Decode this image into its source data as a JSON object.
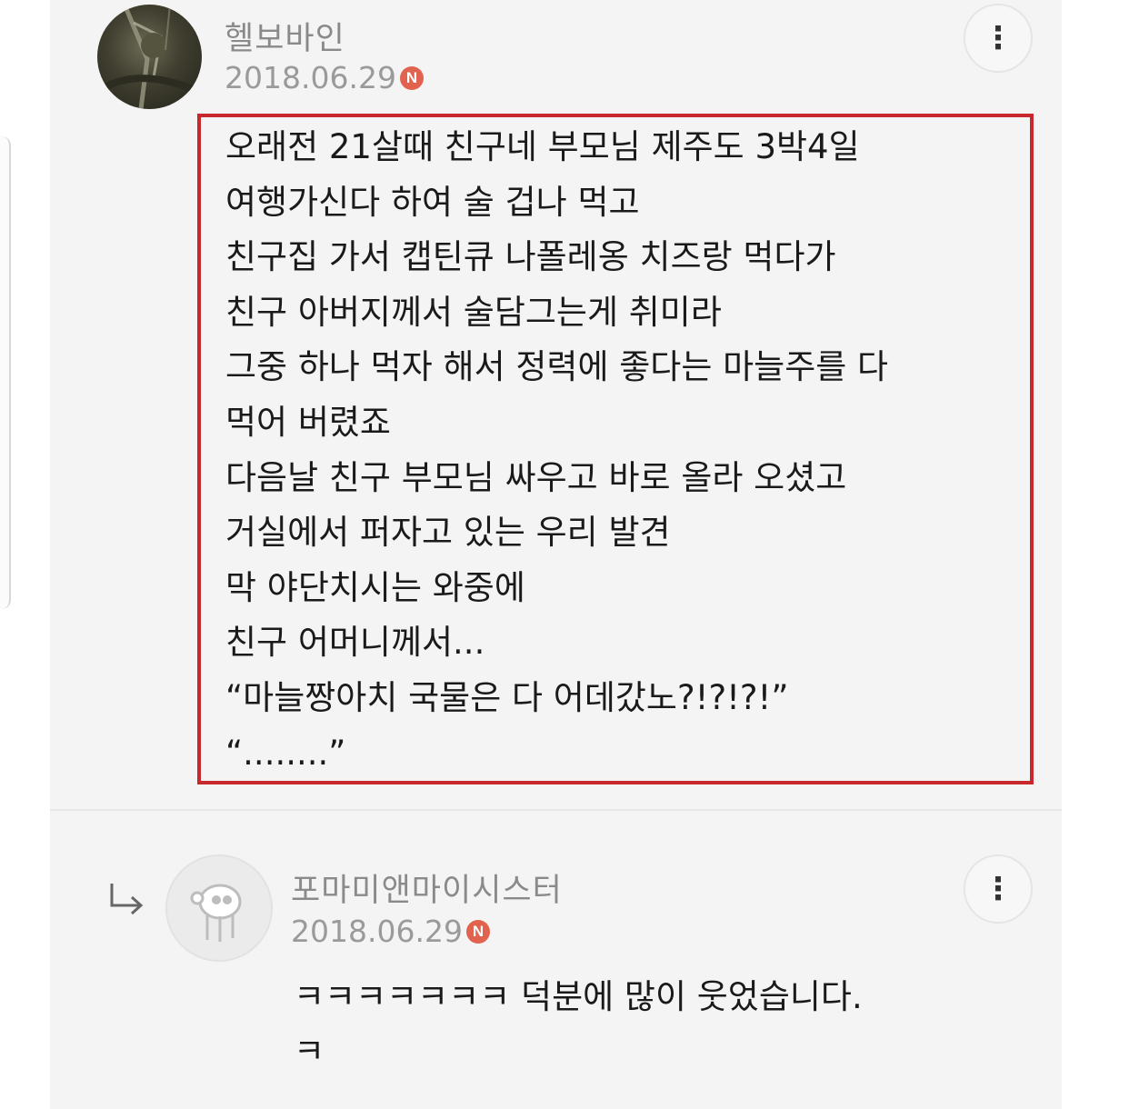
{
  "comments": [
    {
      "author": "헬보바인",
      "date": "2018.06.29",
      "badge": "N",
      "more_icon": "⋮",
      "lines": [
        "오래전 21살때 친구네 부모님 제주도 3박4일",
        "여행가신다 하여 술 겁나 먹고",
        "친구집 가서 캡틴큐 나폴레옹 치즈랑 먹다가",
        "친구 아버지께서 술담그는게 취미라",
        "그중 하나 먹자 해서 정력에 좋다는 마늘주를 다",
        "먹어 버렸죠",
        "다음날 친구 부모님 싸우고 바로 올라 오셨고",
        "거실에서 퍼자고 있는 우리 발견",
        "막 야단치시는 와중에",
        "친구 어머니께서...",
        "“마늘짱아치 국물은 다 어데갔노?!?!?!”",
        "“........”"
      ]
    },
    {
      "author": "포마미앤마이시스터",
      "date": "2018.06.29",
      "badge": "N",
      "more_icon": "⋮",
      "lines": [
        "ㅋㅋㅋㅋㅋㅋㅋ 덕분에 많이 웃었습니다.",
        "ㅋ"
      ]
    }
  ],
  "colors": {
    "highlight_border": "#c6282b",
    "new_badge": "#e0624f",
    "author_text": "#8a8a8a"
  }
}
